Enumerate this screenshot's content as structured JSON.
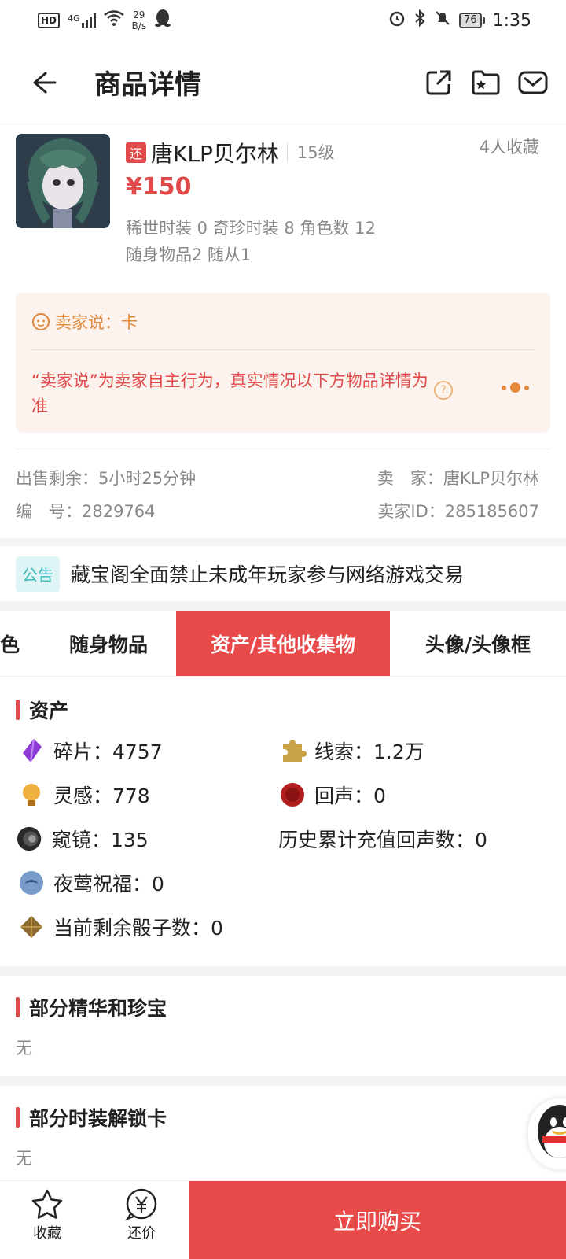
{
  "status_bar": {
    "hd": "HD",
    "network": "4G",
    "speed_value": "29",
    "speed_unit": "B/s",
    "battery": "76",
    "time": "1:35"
  },
  "header": {
    "title": "商品详情",
    "icons": [
      "back-arrow-icon",
      "share-icon",
      "folder-star-icon",
      "mail-icon"
    ]
  },
  "product": {
    "tag": "还",
    "name": "唐KLP贝尔林",
    "level": "15级",
    "favorites": "4人收藏",
    "price": "¥150",
    "summary_line1": "稀世时装 0 奇珍时装 8 角色数 12",
    "summary_line2": "随身物品2 随从1"
  },
  "seller_note": {
    "says": "卖家说：卡",
    "disclaimer": "“卖家说”为卖家自主行为，真实情况以下方物品详情为准",
    "help": "?"
  },
  "meta": {
    "remaining_time": "出售剩余：5小时25分钟",
    "seller": "卖　家：唐KLP贝尔林",
    "number": "编　号：2829764",
    "seller_id": "卖家ID：285185607"
  },
  "notice": {
    "badge": "公告",
    "text": "藏宝阁全面禁止未成年玩家参与网络游戏交易"
  },
  "tabs": [
    {
      "label": "色",
      "active": false
    },
    {
      "label": "随身物品",
      "active": false
    },
    {
      "label": "资产/其他收集物",
      "active": true
    },
    {
      "label": "头像/头像框",
      "active": false
    }
  ],
  "assets": {
    "title": "资产",
    "items": [
      {
        "label": "碎片：4757",
        "icon": "purple-shard-icon"
      },
      {
        "label": "线索：1.2万",
        "icon": "puzzle-clue-icon"
      },
      {
        "label": "灵感：778",
        "icon": "lightbulb-inspiration-icon"
      },
      {
        "label": "回声：0",
        "icon": "red-seal-echo-icon"
      },
      {
        "label": "窥镜：135",
        "icon": "telescope-lens-icon"
      },
      {
        "label": "历史累计充值回声数：0",
        "icon": ""
      },
      {
        "label": "夜莺祝福：0",
        "icon": "nightingale-blessing-icon"
      },
      {
        "label": "当前剩余骰子数：0",
        "icon": "dice-icon"
      }
    ]
  },
  "essence": {
    "title": "部分精华和珍宝",
    "value": "无"
  },
  "costume_cards": {
    "title": "部分时装解锁卡",
    "value": "无"
  },
  "bottom_bar": {
    "favorite_label": "收藏",
    "bargain_label": "还价",
    "buy_label": "立即购买"
  },
  "colors": {
    "accent_red": "#e84a4a",
    "price_red": "#e04a4a",
    "seller_orange": "#e0883c",
    "notice_teal": "#3bb8b8"
  }
}
